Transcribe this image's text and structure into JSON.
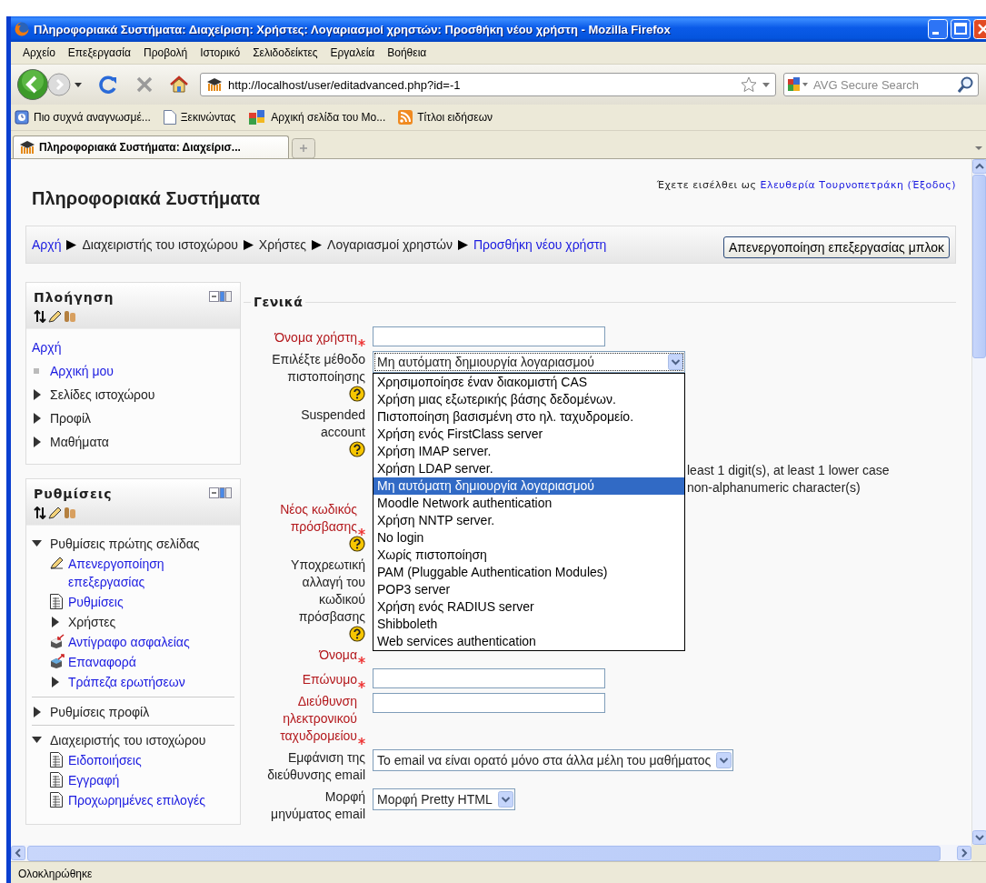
{
  "window": {
    "title": "Πληροφοριακά Συστήματα: Διαχείριση: Χρήστες: Λογαριασμοί χρηστών: Προσθήκη νέου χρήστη - Mozilla Firefox"
  },
  "menu": [
    "Αρχείο",
    "Επεξεργασία",
    "Προβολή",
    "Ιστορικό",
    "Σελιδοδείκτες",
    "Εργαλεία",
    "Βοήθεια"
  ],
  "address_bar": {
    "value": "http://localhost/user/editadvanced.php?id=-1"
  },
  "search": {
    "placeholder": "AVG Secure Search"
  },
  "bookmarks": [
    {
      "label": "Πιο συχνά αναγνωσμέ...",
      "kind": "history"
    },
    {
      "label": "Ξεκινώντας",
      "kind": "page"
    },
    {
      "label": "Αρχική σελίδα του Mo...",
      "kind": "tiles"
    },
    {
      "label": "Τίτλοι ειδήσεων",
      "kind": "feed"
    }
  ],
  "tabs": [
    {
      "label": "Πληροφοριακά Συστήματα: Διαχείρισ...",
      "selected": true
    }
  ],
  "page": {
    "login": {
      "prefix": "Έχετε εισέλθει ως",
      "user": "Ελευθερία Τουρνοπετράκη",
      "logout": "(Έξοδος)"
    },
    "site_title": "Πληροφοριακά Συστήματα",
    "breadcrumb": [
      {
        "label": "Αρχή",
        "link": true
      },
      {
        "label": "Διαχειριστής του ιστοχώρου",
        "link": false
      },
      {
        "label": "Χρήστες",
        "link": false
      },
      {
        "label": "Λογαριασμοί χρηστών",
        "link": false
      },
      {
        "label": "Προσθήκη νέου χρήστη",
        "link": true
      }
    ],
    "edit_button": "Απενεργοποίηση επεξεργασίας μπλοκ"
  },
  "blocks": [
    {
      "title": "Πλοήγηση",
      "items": [
        {
          "label": "Αρχή",
          "kind": "root",
          "link": true
        },
        {
          "label": "Αρχική μου",
          "kind": "leaf",
          "link": true
        },
        {
          "label": "Σελίδες ιστοχώρου",
          "kind": "branch",
          "link": false,
          "expanded": false
        },
        {
          "label": "Προφίλ",
          "kind": "branch",
          "link": false,
          "expanded": false
        },
        {
          "label": "Μαθήματα",
          "kind": "branch",
          "link": false,
          "expanded": false
        }
      ]
    },
    {
      "title": "Ρυθμίσεις",
      "items": [
        {
          "label": "Ρυθμίσεις πρώτης σελίδας",
          "kind": "branch",
          "link": false,
          "expanded": true,
          "children": [
            {
              "label": "Απενεργοποίηση επεξεργασίας",
              "kind": "edit",
              "link": true
            },
            {
              "label": "Ρυθμίσεις",
              "kind": "page",
              "link": true
            },
            {
              "label": "Χρήστες",
              "kind": "branch",
              "link": false,
              "expanded": false
            },
            {
              "label": "Αντίγραφο ασφαλείας",
              "kind": "backup",
              "link": true
            },
            {
              "label": "Επαναφορά",
              "kind": "restore",
              "link": true
            },
            {
              "label": "Τράπεζα ερωτήσεων",
              "kind": "branch",
              "link": true,
              "expanded": false
            }
          ]
        },
        {
          "label": "Ρυθμίσεις προφίλ",
          "kind": "branch",
          "link": false,
          "expanded": false
        },
        {
          "label": "Διαχειριστής του ιστοχώρου",
          "kind": "branch",
          "link": false,
          "expanded": true,
          "children": [
            {
              "label": "Ειδοποιήσεις",
              "kind": "page",
              "link": true
            },
            {
              "label": "Εγγραφή",
              "kind": "page",
              "link": true
            },
            {
              "label": "Προχωρημένες επιλογές",
              "kind": "page",
              "link": true
            }
          ]
        }
      ]
    }
  ],
  "form": {
    "legend": "Γενικά",
    "fields": [
      {
        "kind": "text",
        "label": "Όνομα χρήστη",
        "required": true,
        "help": false
      },
      {
        "kind": "select",
        "label": "Επιλέξτε μέθοδο πιστοποίησης",
        "required": false,
        "help": true,
        "value": "Μη αυτόματη δημιουργία λογαριασμού",
        "open": true,
        "options": [
          {
            "label": "Χρησιμοποίησε έναν διακομιστή CAS",
            "selected": false
          },
          {
            "label": "Χρήση μιας εξωτερικής βάσης δεδομένων.",
            "selected": false
          },
          {
            "label": "Πιστοποίηση βασισμένη στο ηλ. ταχυδρομείο.",
            "selected": false
          },
          {
            "label": "Χρήση ενός FirstClass server",
            "selected": false
          },
          {
            "label": "Χρήση IMAP server.",
            "selected": false
          },
          {
            "label": "Χρήση LDAP server.",
            "selected": false
          },
          {
            "label": "Μη αυτόματη δημιουργία λογαριασμού",
            "selected": true
          },
          {
            "label": "Moodle Network authentication",
            "selected": false
          },
          {
            "label": "Χρήση NNTP server.",
            "selected": false
          },
          {
            "label": "No login",
            "selected": false
          },
          {
            "label": "Χωρίς πιστοποίηση",
            "selected": false
          },
          {
            "label": "PAM (Pluggable Authentication Modules)",
            "selected": false
          },
          {
            "label": "POP3 server",
            "selected": false
          },
          {
            "label": "Χρήση ενός RADIUS server",
            "selected": false
          },
          {
            "label": "Shibboleth",
            "selected": false
          },
          {
            "label": "Web services authentication",
            "selected": false
          }
        ]
      },
      {
        "kind": "label",
        "label": "Suspended account",
        "required": false,
        "help": true
      },
      {
        "kind": "note",
        "lines": [
          "least 1 digit(s), at least 1 lower case",
          "non-alphanumeric character(s)"
        ]
      },
      {
        "kind": "label",
        "label": "Νέος κωδικός πρόσβασης",
        "required": true,
        "help": true
      },
      {
        "kind": "label",
        "label": "Υποχρεωτική αλλαγή του κωδικού πρόσβασης",
        "required": false,
        "help": true
      },
      {
        "kind": "label",
        "label": "Όνομα",
        "required": true,
        "help": false
      },
      {
        "kind": "text",
        "label": "Επώνυμο",
        "required": true,
        "help": false
      },
      {
        "kind": "text",
        "label": "Διεύθυνση ηλεκτρονικού ταχυδρομείου",
        "required": true,
        "help": false
      },
      {
        "kind": "select",
        "label": "Εμφάνιση της διεύθυνσης email",
        "required": false,
        "help": false,
        "value": "Το email να είναι ορατό μόνο στα άλλα μέλη του μαθήματος",
        "open": false
      },
      {
        "kind": "select",
        "label": "Μορφή μηνύματος email",
        "required": false,
        "help": false,
        "value": "Μορφή Pretty HTML",
        "open": false
      }
    ]
  },
  "status_bar": "Ολοκληρώθηκε"
}
